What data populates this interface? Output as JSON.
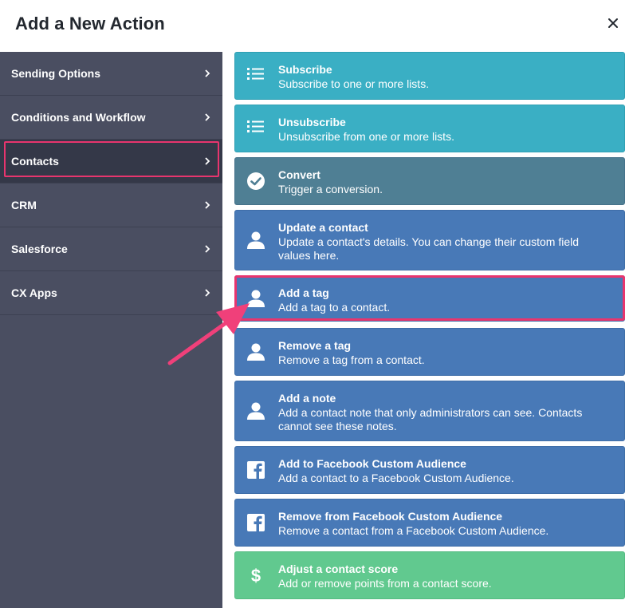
{
  "header": {
    "title": "Add a New Action"
  },
  "sidebar": {
    "items": [
      {
        "label": "Sending Options"
      },
      {
        "label": "Conditions and Workflow"
      },
      {
        "label": "Contacts"
      },
      {
        "label": "CRM"
      },
      {
        "label": "Salesforce"
      },
      {
        "label": "CX Apps"
      }
    ]
  },
  "actions": [
    {
      "title": "Subscribe",
      "desc": "Subscribe to one or more lists.",
      "icon": "list-icon"
    },
    {
      "title": "Unsubscribe",
      "desc": "Unsubscribe from one or more lists.",
      "icon": "list-icon"
    },
    {
      "title": "Convert",
      "desc": "Trigger a conversion.",
      "icon": "check-circle-icon"
    },
    {
      "title": "Update a contact",
      "desc": "Update a contact's details. You can change their custom field values here.",
      "icon": "person-icon"
    },
    {
      "title": "Add a tag",
      "desc": "Add a tag to a contact.",
      "icon": "person-icon"
    },
    {
      "title": "Remove a tag",
      "desc": "Remove a tag from a contact.",
      "icon": "person-icon"
    },
    {
      "title": "Add a note",
      "desc": "Add a contact note that only administrators can see. Contacts cannot see these notes.",
      "icon": "person-icon"
    },
    {
      "title": "Add to Facebook Custom Audience",
      "desc": "Add a contact to a Facebook Custom Audience.",
      "icon": "facebook-icon"
    },
    {
      "title": "Remove from Facebook Custom Audience",
      "desc": "Remove a contact from a Facebook Custom Audience.",
      "icon": "facebook-icon"
    },
    {
      "title": "Adjust a contact score",
      "desc": "Add or remove points from a contact score.",
      "icon": "dollar-icon"
    }
  ],
  "colors": {
    "sidebar_bg": "#4a4e61",
    "sidebar_active": "#343848",
    "highlight": "#e8356e",
    "teal": "#3aafc4",
    "slate": "#4f7f94",
    "blue": "#4879b7",
    "green": "#61c98f"
  }
}
